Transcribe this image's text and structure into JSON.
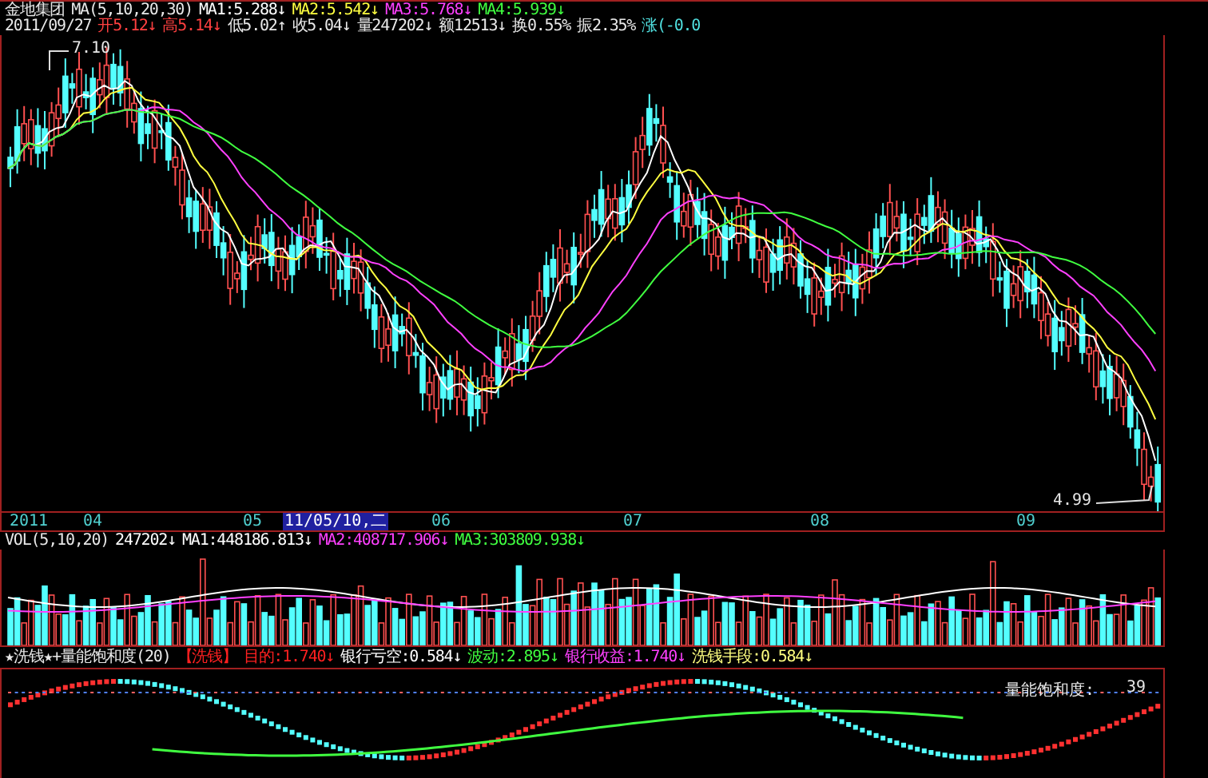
{
  "header": {
    "stock_name": "金地集团",
    "ma_label": "MA(5,10,20,30)",
    "ma_items": [
      {
        "text": "MA1:5.288↓",
        "color": "#ffffff"
      },
      {
        "text": "MA2:5.542↓",
        "color": "#ffff40"
      },
      {
        "text": "MA3:5.768↓",
        "color": "#ff40ff"
      },
      {
        "text": "MA4:5.939↓",
        "color": "#40ff40"
      }
    ]
  },
  "quote_line": {
    "date": "2011/09/27",
    "items": [
      {
        "text": "开5.12↓",
        "color": "#ff4040"
      },
      {
        "text": "高5.14↓",
        "color": "#ff4040"
      },
      {
        "text": "低5.02↑",
        "color": "#e8e8e8"
      },
      {
        "text": "收5.04↓",
        "color": "#e8e8e8"
      },
      {
        "text": "量247202↓",
        "color": "#e8e8e8"
      },
      {
        "text": "额12513↓",
        "color": "#e8e8e8"
      },
      {
        "text": "换0.55%",
        "color": "#e8e8e8"
      },
      {
        "text": "振2.35%",
        "color": "#e8e8e8"
      },
      {
        "text": "涨(-0.0",
        "color": "#50e0e0"
      }
    ]
  },
  "price_chart": {
    "high_label": "7.10",
    "low_label": "4.99"
  },
  "time_axis": {
    "ticks": [
      {
        "label": "2011",
        "selected": false
      },
      {
        "label": "04",
        "selected": false
      },
      {
        "label": "05",
        "selected": false
      },
      {
        "label": "11/05/10,二",
        "selected": true
      },
      {
        "label": "06",
        "selected": false
      },
      {
        "label": "07",
        "selected": false
      },
      {
        "label": "08",
        "selected": false
      },
      {
        "label": "09",
        "selected": false
      }
    ]
  },
  "volume": {
    "label": "VOL(5,10,20)",
    "items": [
      {
        "text": "247202↓",
        "color": "#ffffff"
      },
      {
        "text": "MA1:448186.813↓",
        "color": "#ffffff"
      },
      {
        "text": "MA2:408717.906↓",
        "color": "#ff40ff"
      },
      {
        "text": "MA3:303809.938↓",
        "color": "#40ff40"
      }
    ]
  },
  "indicator": {
    "label": "★洗钱★+量能饱和度(20)",
    "items": [
      {
        "text": "【洗钱】",
        "color": "#ff2020"
      },
      {
        "text": "目的:1.740↓",
        "color": "#ff2020"
      },
      {
        "text": "银行亏空:0.584↓",
        "color": "#ffffff"
      },
      {
        "text": "波动:2.895↓",
        "color": "#40ff40"
      },
      {
        "text": "银行收益:1.740↓",
        "color": "#ff40ff"
      },
      {
        "text": "洗钱手段:0.584↓",
        "color": "#ffff80"
      }
    ],
    "saturation_label": "量能饱和度:",
    "saturation_value": "39"
  }
}
